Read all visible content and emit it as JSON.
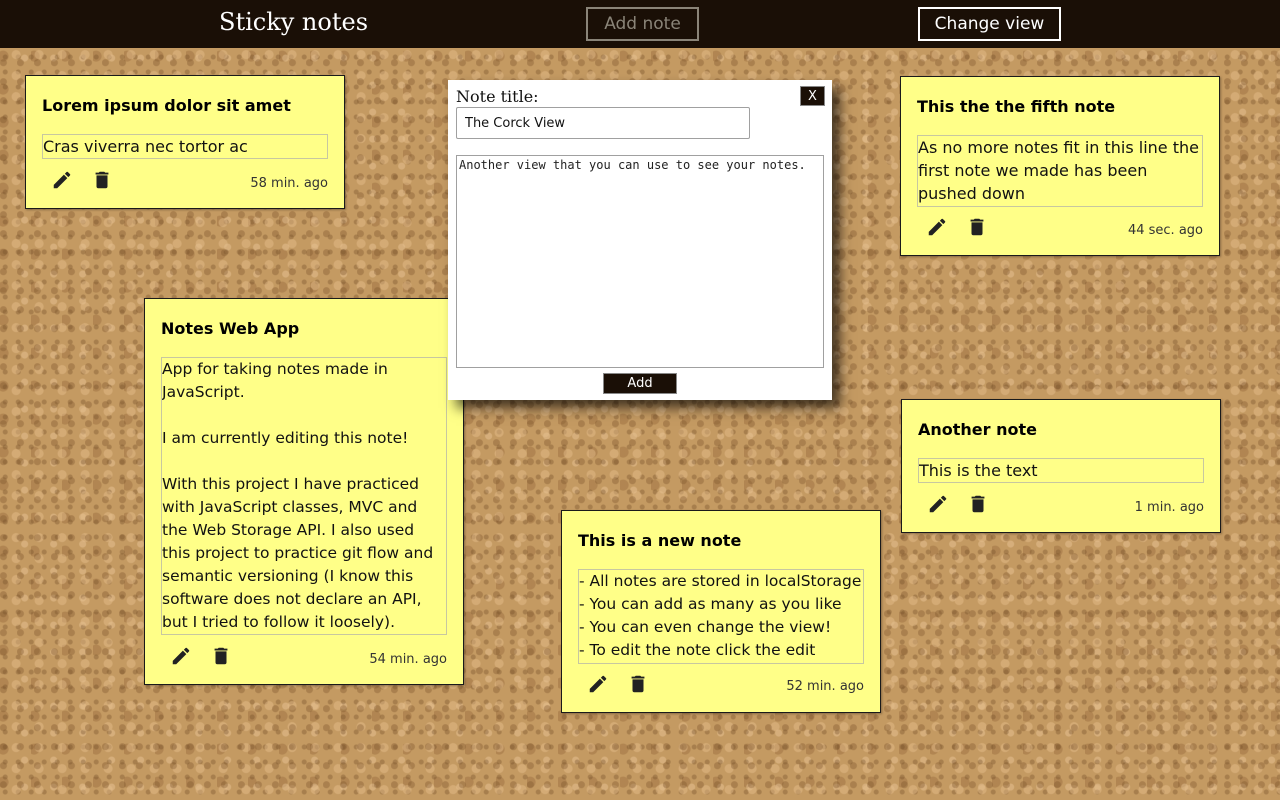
{
  "header": {
    "title": "Sticky notes",
    "add_note_label": "Add note",
    "change_view_label": "Change view"
  },
  "notes": [
    {
      "title": "Lorem ipsum dolor sit amet",
      "text": "Cras viverra nec tortor ac elementum.",
      "time": "58 min. ago"
    },
    {
      "title": "This the the fifth note",
      "text": "As no more notes fit in this line the first note we made has been pushed down",
      "time": "44 sec. ago"
    },
    {
      "title": "Notes Web App",
      "text": "App for taking notes made in JavaScript.\n\nI am currently editing this note!\n\nWith this project I have practiced with JavaScript classes, MVC and the Web Storage API. I also used this project to practice git flow and semantic versioning (I know this software does not declare an API, but I tried to follow it loosely).",
      "time": "54 min. ago"
    },
    {
      "title": "Another note",
      "text": "This is the text",
      "time": "1 min. ago"
    },
    {
      "title": "This is a new note",
      "text": "- All notes are stored in localStorage\n- You can add as many as you like\n- You can even change the view!\n- To edit the note click the edit button",
      "time": "52 min. ago"
    }
  ],
  "icons": {
    "edit": "pencil-icon",
    "delete": "trash-icon"
  },
  "modal": {
    "label": "Note title:",
    "close_label": "X",
    "title_value": "The Corck View",
    "body_value": "Another view that you can use to see your notes.",
    "add_label": "Add"
  },
  "colors": {
    "header_bg": "#1a0f06",
    "note_bg": "#ffff88",
    "cork": "#c49a62"
  }
}
